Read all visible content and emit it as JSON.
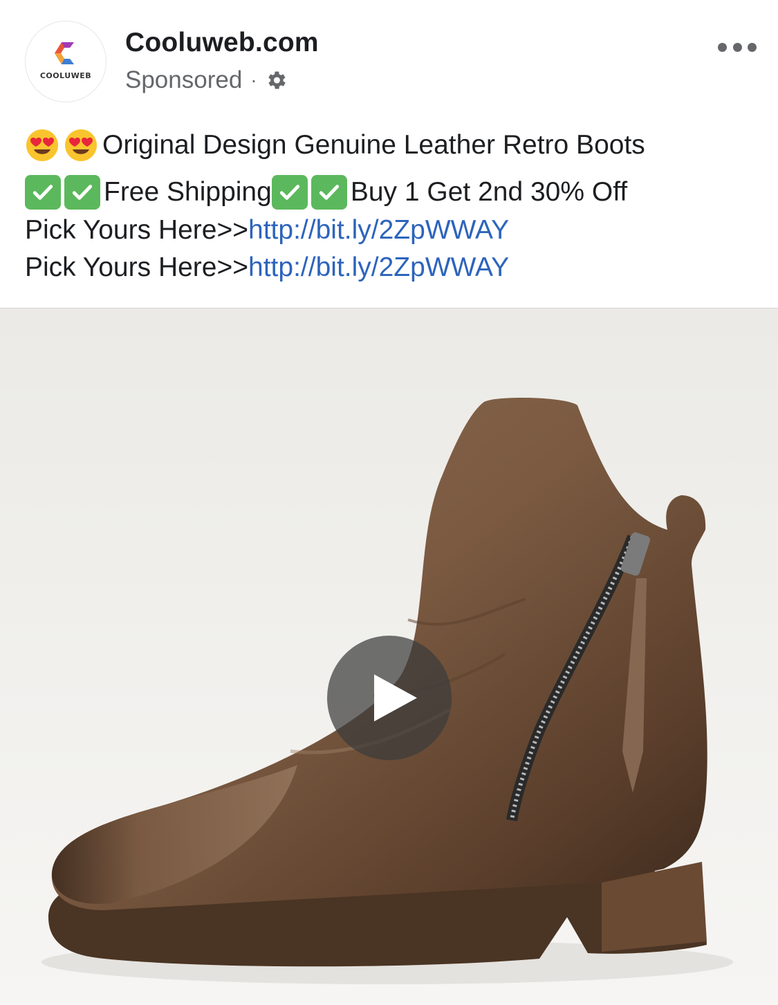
{
  "post": {
    "page_name": "Cooluweb.com",
    "avatar_text": "COOLUWEB",
    "sponsored_label": "Sponsored",
    "separator": "·",
    "lines": {
      "line1_text": "Original Design Genuine Leather Retro Boots",
      "line2_text_a": "Free Shipping",
      "line2_text_b": "Buy 1 Get 2nd 30% Off",
      "line3_prefix": "Pick Yours Here>>",
      "line3_link": "http://bit.ly/2ZpWWAY",
      "line4_prefix": "Pick Yours Here>>",
      "line4_link": "http://bit.ly/2ZpWWAY"
    }
  },
  "icons": {
    "avatar_logo": "cooluweb-logo",
    "settings": "gear-icon",
    "more": "more-options-icon",
    "emoji_heart_eyes": "heart-eyes-emoji",
    "emoji_check": "check-mark-button-emoji",
    "play": "play-icon"
  },
  "colors": {
    "link": "#2d64bc",
    "secondary_text": "#65676b",
    "check_green": "#5cb85c",
    "boot_brown": "#7a5a42"
  }
}
